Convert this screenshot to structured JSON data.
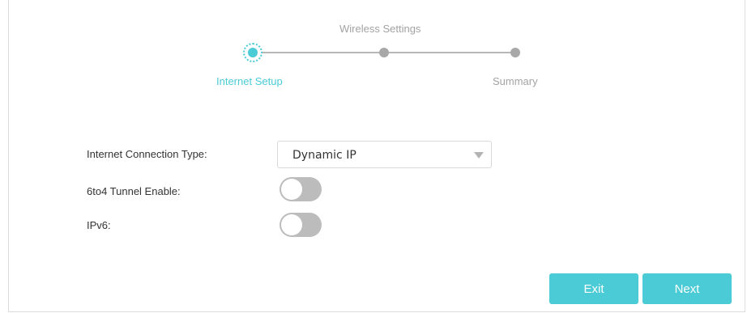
{
  "stepper": {
    "steps": [
      {
        "label": "Internet Setup",
        "state": "active"
      },
      {
        "label": "Wireless Settings",
        "state": "pending"
      },
      {
        "label": "Summary",
        "state": "pending"
      }
    ],
    "active_color": "#4acbd6",
    "inactive_color": "#a8a8a8"
  },
  "form": {
    "connection_type": {
      "label": "Internet Connection Type:",
      "value": "Dynamic IP"
    },
    "tunnel": {
      "label": "6to4 Tunnel Enable:",
      "enabled": false
    },
    "ipv6": {
      "label": "IPv6:",
      "enabled": false
    }
  },
  "buttons": {
    "exit_label": "Exit",
    "next_label": "Next",
    "color": "#4acbd6"
  }
}
